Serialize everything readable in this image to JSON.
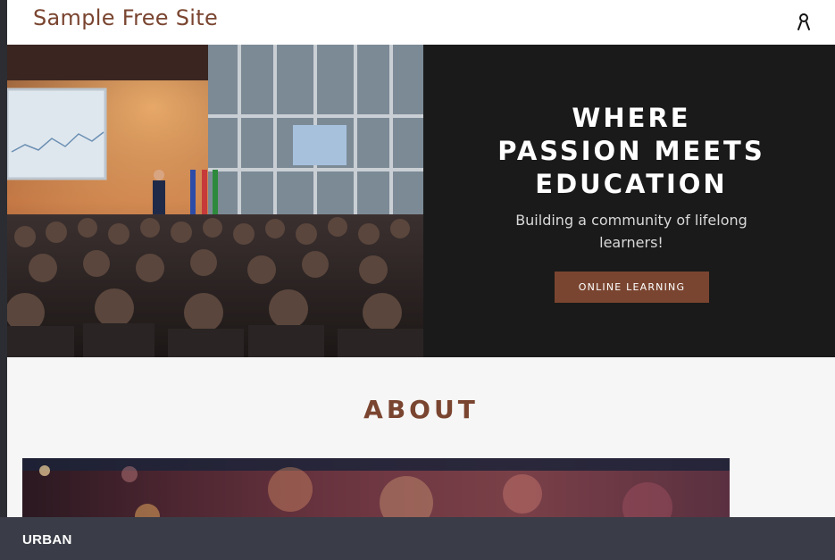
{
  "header": {
    "site_title": "Sample Free Site",
    "account_icon": "user-account-icon"
  },
  "hero": {
    "image_alt": "conference-audience-photo",
    "heading_line1": "WHERE",
    "heading_line2": "PASSION MEETS",
    "heading_line3": "EDUCATION",
    "subtitle": "Building a community of lifelong learners!",
    "cta_label": "ONLINE LEARNING"
  },
  "about": {
    "title": "ABOUT"
  },
  "footer": {
    "brand": "URBAN"
  },
  "colors": {
    "accent": "#7a4530",
    "hero_panel": "#1a1a1a",
    "footer_bar": "#3a3d47"
  }
}
